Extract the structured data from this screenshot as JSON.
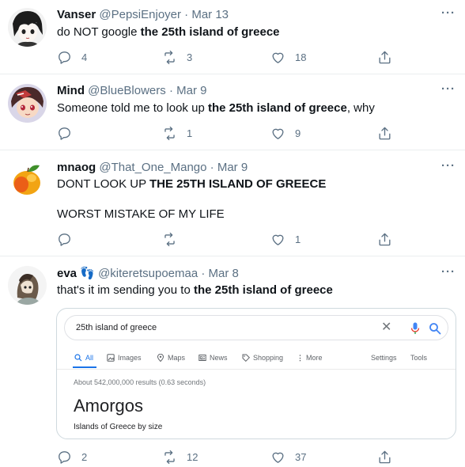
{
  "tweets": [
    {
      "name": "Vanser",
      "handle": "@PepsiEnjoyer",
      "date": "Mar 13",
      "text_before": "do NOT google ",
      "text_bold": "the 25th island of greece",
      "text_after": "",
      "replies": "4",
      "retweets": "3",
      "likes": "18"
    },
    {
      "name": "Mind",
      "handle": "@BlueBlowers",
      "date": "Mar 9",
      "text_before": "Someone told me to look up ",
      "text_bold": "the 25th island of greece",
      "text_after": ", why",
      "replies": "",
      "retweets": "1",
      "likes": "9"
    },
    {
      "name": "mnaog",
      "handle": "@That_One_Mango",
      "date": "Mar 9",
      "text_before": "DONT LOOK UP ",
      "text_bold": "THE 25TH ISLAND OF GREECE",
      "text_after": "",
      "text_line2": "WORST MISTAKE OF MY LIFE",
      "replies": "",
      "retweets": "",
      "likes": "1"
    },
    {
      "name": "eva",
      "name_emoji": "👣",
      "handle": "@kiteretsupoemaa",
      "date": "Mar 8",
      "text_before": "that's it im sending you to ",
      "text_bold": "the 25th island of greece",
      "text_after": "",
      "replies": "2",
      "retweets": "12",
      "likes": "37"
    }
  ],
  "separator": "·",
  "more_label": "···",
  "google": {
    "query": "25th island of greece",
    "clear_glyph": "✕",
    "tabs": [
      "All",
      "Images",
      "Maps",
      "News",
      "Shopping",
      "More"
    ],
    "settings": "Settings",
    "tools": "Tools",
    "results_count": "About 542,000,000 results (0.63 seconds)",
    "answer_title": "Amorgos",
    "answer_subtitle": "Islands of Greece by size",
    "accent_color": "#1a73e8"
  },
  "icons": {
    "reply": "reply-icon",
    "retweet": "retweet-icon",
    "like": "heart-icon",
    "share": "share-icon"
  }
}
